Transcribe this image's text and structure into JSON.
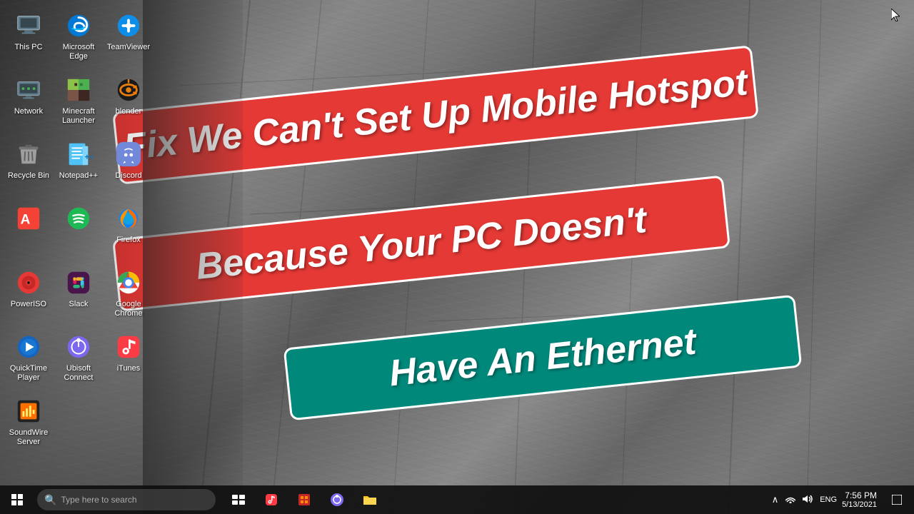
{
  "desktop": {
    "icons": [
      {
        "id": "this-pc",
        "label": "This PC",
        "icon": "💻",
        "class": "icon-thispc"
      },
      {
        "id": "microsoft-edge",
        "label": "Microsoft Edge",
        "icon": "🌐",
        "class": "icon-edge"
      },
      {
        "id": "teamviewer",
        "label": "TeamViewer",
        "icon": "🔵",
        "class": "icon-teamviewer"
      },
      {
        "id": "network",
        "label": "Network",
        "icon": "🌐",
        "class": "icon-network"
      },
      {
        "id": "minecraft-launcher",
        "label": "Minecraft Launcher",
        "icon": "🎮",
        "class": "icon-minecraft"
      },
      {
        "id": "blender",
        "label": "blender",
        "icon": "🔶",
        "class": "icon-blender"
      },
      {
        "id": "recycle-bin",
        "label": "Recycle Bin",
        "icon": "🗑️",
        "class": "icon-recycle"
      },
      {
        "id": "notepadpp",
        "label": "Notepad++",
        "icon": "📝",
        "class": "icon-notepad"
      },
      {
        "id": "discord",
        "label": "Discord",
        "icon": "💬",
        "class": "icon-discord"
      },
      {
        "id": "acrobat",
        "label": "",
        "icon": "📄",
        "class": "icon-acrobat"
      },
      {
        "id": "spotify",
        "label": "",
        "icon": "🎵",
        "class": "icon-spotify"
      },
      {
        "id": "firefox",
        "label": "Firefox",
        "icon": "🦊",
        "class": "icon-firefox"
      },
      {
        "id": "poweriso",
        "label": "PowerISO",
        "icon": "💿",
        "class": "icon-poweriso"
      },
      {
        "id": "slack",
        "label": "Slack",
        "icon": "💼",
        "class": "icon-slack"
      },
      {
        "id": "google-chrome",
        "label": "Google Chrome",
        "icon": "🌐",
        "class": "icon-chrome"
      },
      {
        "id": "quicktime-player",
        "label": "QuickTime Player",
        "icon": "⏯️",
        "class": "icon-quicktime"
      },
      {
        "id": "ubisoft-connect",
        "label": "Ubisoft Connect",
        "icon": "🎮",
        "class": "icon-ubisoft"
      },
      {
        "id": "itunes",
        "label": "iTunes",
        "icon": "🎵",
        "class": "icon-itunes"
      },
      {
        "id": "soundwire-server",
        "label": "SoundWire Server",
        "icon": "🔊",
        "class": "icon-soundwire"
      }
    ]
  },
  "banners": [
    {
      "id": "banner-1",
      "text": "Fix We Can't Set Up Mobile Hotspot",
      "color": "red",
      "class": "banner-1"
    },
    {
      "id": "banner-2",
      "text": "Because Your PC Doesn't",
      "color": "red",
      "class": "banner-2"
    },
    {
      "id": "banner-3",
      "text": "Have An Ethernet",
      "color": "teal",
      "class": "banner-3"
    }
  ],
  "taskbar": {
    "search_placeholder": "Type here to search",
    "clock": {
      "time": "7:56 PM",
      "date": "5/13/2021"
    },
    "tray_icons": [
      "^",
      "☁",
      "📶",
      "🔊",
      "ENG"
    ],
    "center_icons": [
      "⊞",
      "🎵",
      "🎬",
      "🔄",
      "📁"
    ]
  }
}
